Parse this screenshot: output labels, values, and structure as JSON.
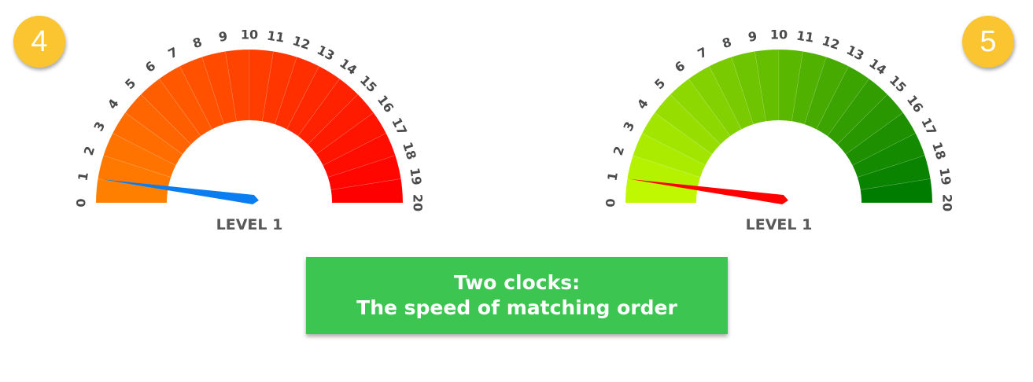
{
  "badges": {
    "left": "4",
    "right": "5"
  },
  "gauges": [
    {
      "ticks": [
        "0",
        "1",
        "2",
        "3",
        "4",
        "5",
        "6",
        "7",
        "8",
        "9",
        "10",
        "11",
        "12",
        "13",
        "14",
        "15",
        "16",
        "17",
        "18",
        "19",
        "20"
      ],
      "min": 0,
      "max": 20,
      "value": 1,
      "level_label": "LEVEL 1",
      "color_start": "#ff8000",
      "color_end": "#ff0000",
      "needle_color": "#0a7ef0",
      "needle_icon": "needle-pointer"
    },
    {
      "ticks": [
        "0",
        "1",
        "2",
        "3",
        "4",
        "5",
        "6",
        "7",
        "8",
        "9",
        "10",
        "11",
        "12",
        "13",
        "14",
        "15",
        "16",
        "17",
        "18",
        "19",
        "20"
      ],
      "min": 0,
      "max": 20,
      "value": 1,
      "level_label": "LEVEL 1",
      "color_start": "#bff800",
      "color_end": "#007d00",
      "needle_color": "#ff0000",
      "needle_icon": "needle-pointer"
    }
  ],
  "caption": {
    "line1": "Two clocks:",
    "line2": "The speed of matching order"
  },
  "colors": {
    "badge": "#fbc531",
    "caption_bg": "#3cc651"
  }
}
